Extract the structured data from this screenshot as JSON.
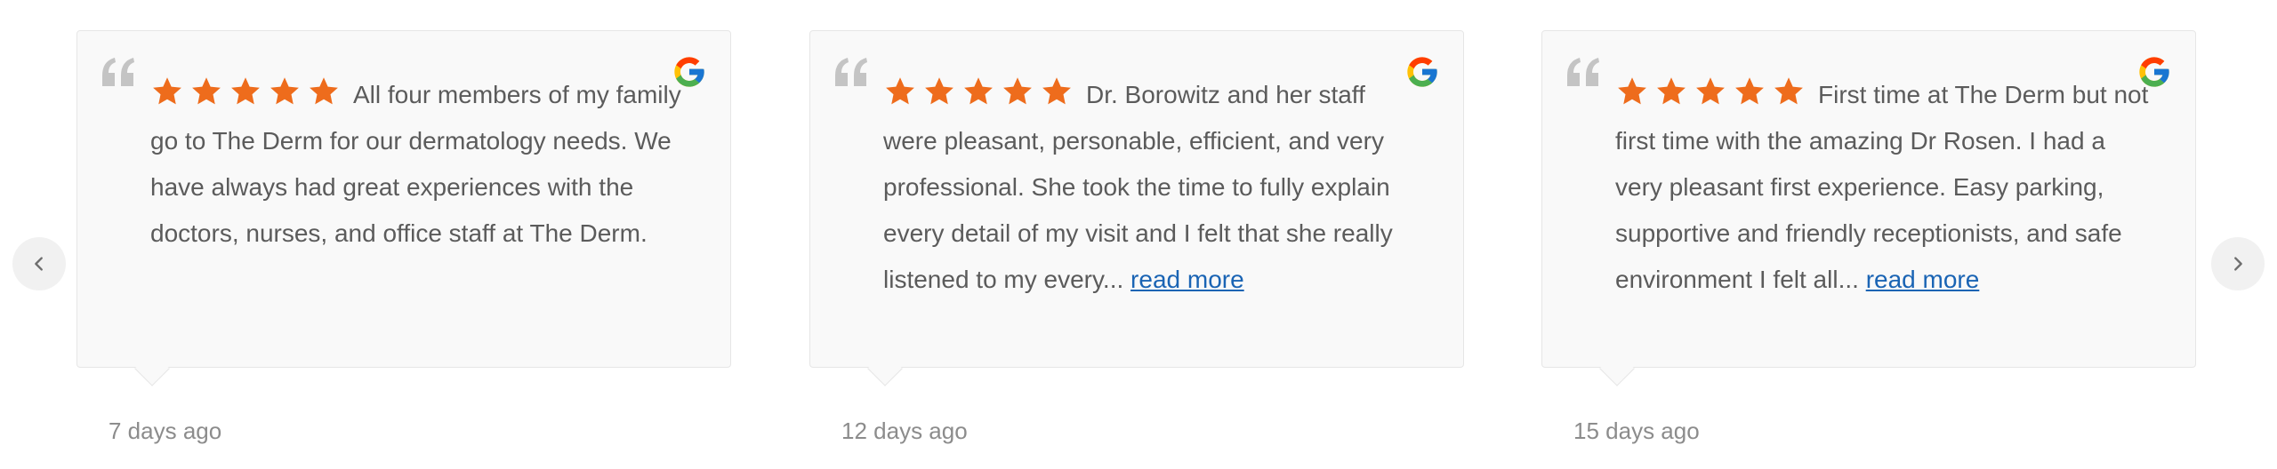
{
  "colors": {
    "star": "#ee6c1c",
    "link": "#1a64b4",
    "text": "#5b5b5b",
    "date": "#8c8c8c",
    "card_bg": "#f9f9f9"
  },
  "icons": {
    "prev": "chevron-left-icon",
    "next": "chevron-right-icon",
    "quote": "quote-icon",
    "source": "google-icon",
    "star": "star-icon"
  },
  "reviews": [
    {
      "rating": 5,
      "text": "All four members of my family go to The Derm for our dermatology needs. We have always had great experiences with the doctors, nurses, and office staff at The Derm.",
      "read_more": "",
      "date": "7 days ago"
    },
    {
      "rating": 5,
      "text": "Dr. Borowitz and her staff were pleasant, personable, efficient, and very professional. She took the time to fully explain every detail of my visit and I felt that she really listened to my every...",
      "read_more": "read more",
      "date": "12 days ago"
    },
    {
      "rating": 5,
      "text": "First time at The Derm but not first time with the amazing Dr Rosen. I had a very pleasant first experience. Easy parking, supportive and friendly receptionists, and safe environment I felt all...",
      "read_more": "read more",
      "date": "15 days ago"
    }
  ]
}
